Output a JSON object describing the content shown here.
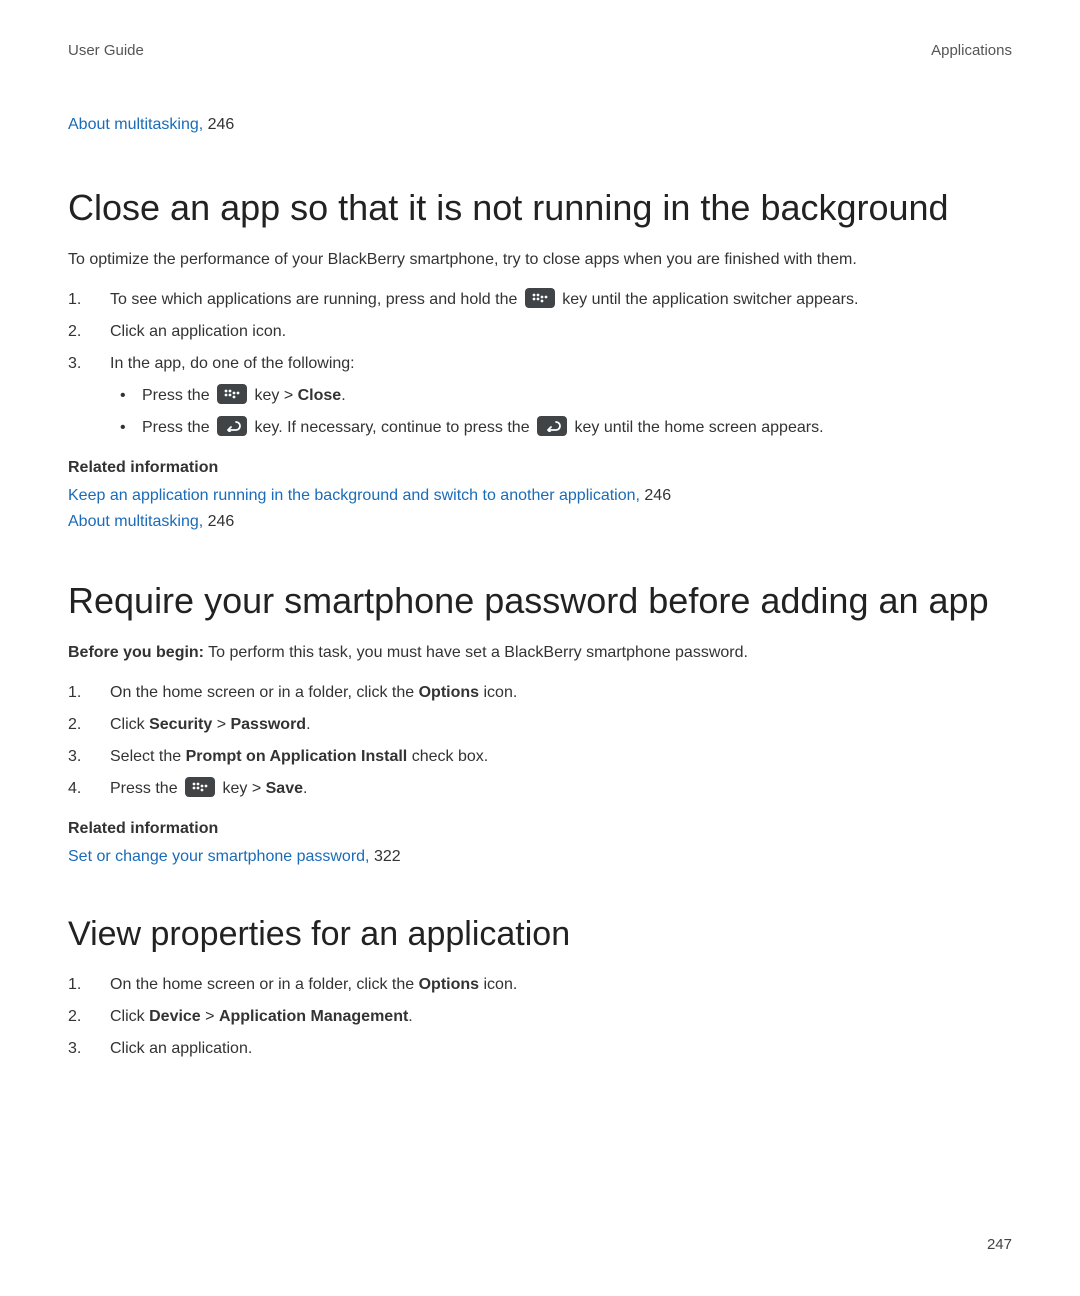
{
  "header": {
    "left": "User Guide",
    "right": "Applications"
  },
  "top_related": {
    "link_text": "About multitasking,",
    "page": " 246"
  },
  "section1": {
    "heading": "Close an app so that it is not running in the background",
    "intro": "To optimize the performance of your BlackBerry smartphone, try to close apps when you are finished with them.",
    "step1_pre": "To see which applications are running, press and hold the ",
    "step1_post": " key until the application switcher appears.",
    "step2": "Click an application icon.",
    "step3": "In the app, do one of the following:",
    "bullet1_pre": "Press the ",
    "bullet1_mid": " key > ",
    "bullet1_bold": "Close",
    "bullet1_post": ".",
    "bullet2_pre": "Press the ",
    "bullet2_mid": " key. If necessary, continue to press the ",
    "bullet2_post": " key until the home screen appears.",
    "related_heading": "Related information",
    "related1_link": "Keep an application running in the background and switch to another application,",
    "related1_page": " 246",
    "related2_link": "About multitasking,",
    "related2_page": " 246"
  },
  "section2": {
    "heading": "Require your smartphone password before adding an app",
    "prefix_bold": "Before you begin:",
    "prefix_rest": " To perform this task, you must have set a BlackBerry smartphone password.",
    "step1_pre": "On the home screen or in a folder, click the ",
    "step1_bold": "Options",
    "step1_post": " icon.",
    "step2_pre": "Click ",
    "step2_b1": "Security",
    "step2_gt": " > ",
    "step2_b2": "Password",
    "step2_post": ".",
    "step3_pre": "Select the ",
    "step3_bold": "Prompt on Application Install",
    "step3_post": " check box.",
    "step4_pre": "Press the ",
    "step4_mid": " key > ",
    "step4_bold": "Save",
    "step4_post": ".",
    "related_heading": "Related information",
    "related1_link": "Set or change your smartphone password,",
    "related1_page": " 322"
  },
  "section3": {
    "heading": "View properties for an application",
    "step1_pre": "On the home screen or in a folder, click the ",
    "step1_bold": "Options",
    "step1_post": " icon.",
    "step2_pre": "Click ",
    "step2_b1": "Device",
    "step2_gt": " > ",
    "step2_b2": "Application Management",
    "step2_post": ".",
    "step3": "Click an application."
  },
  "page_number": "247"
}
